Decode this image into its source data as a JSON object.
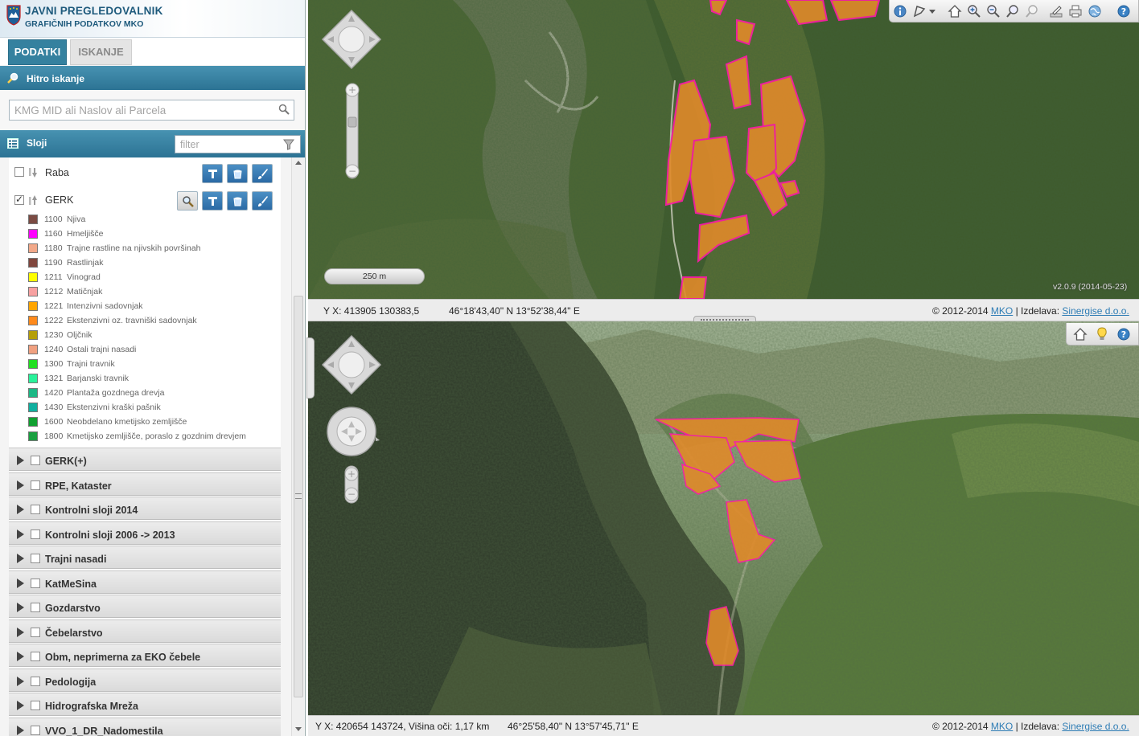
{
  "header": {
    "title_line1": "JAVNI PREGLEDOVALNIK",
    "title_line2": "GRAFIČNIH PODATKOV MKO"
  },
  "tabs": [
    {
      "label": "PODATKI"
    },
    {
      "label": "ISKANJE"
    }
  ],
  "quick_search": {
    "title": "Hitro iskanje",
    "placeholder": "KMG MID ali Naslov ali Parcela"
  },
  "layers_panel": {
    "title": "Sloji",
    "filter_placeholder": "filter"
  },
  "layers": [
    {
      "name": "Raba",
      "checked": false
    },
    {
      "name": "GERK",
      "checked": true
    }
  ],
  "legend": [
    {
      "code": "1100",
      "label": "Njiva",
      "color": "#7b4b43"
    },
    {
      "code": "1160",
      "label": "Hmeljišče",
      "color": "#ff00ff"
    },
    {
      "code": "1180",
      "label": "Trajne rastline na njivskih površinah",
      "color": "#f2a98a"
    },
    {
      "code": "1190",
      "label": "Rastlinjak",
      "color": "#80473e"
    },
    {
      "code": "1211",
      "label": "Vinograd",
      "color": "#ffff00"
    },
    {
      "code": "1212",
      "label": "Matičnjak",
      "color": "#f7a1a1"
    },
    {
      "code": "1221",
      "label": "Intenzivni sadovnjak",
      "color": "#ffa500"
    },
    {
      "code": "1222",
      "label": "Ekstenzivni oz. travniški sadovnjak",
      "color": "#ff8a1c"
    },
    {
      "code": "1230",
      "label": "Oljčnik",
      "color": "#b59f0a"
    },
    {
      "code": "1240",
      "label": "Ostali trajni nasadi",
      "color": "#f0a080"
    },
    {
      "code": "1300",
      "label": "Trajni travnik",
      "color": "#22e022"
    },
    {
      "code": "1321",
      "label": "Barjanski travnik",
      "color": "#29f29a"
    },
    {
      "code": "1420",
      "label": "Plantaža gozdnega drevja",
      "color": "#1cb885"
    },
    {
      "code": "1430",
      "label": "Ekstenzivni kraški pašnik",
      "color": "#10b0a0"
    },
    {
      "code": "1600",
      "label": "Neobdelano kmetijsko zemljišče",
      "color": "#10a030"
    },
    {
      "code": "1800",
      "label": "Kmetijsko zemljišče, poraslo z gozdnim drevjem",
      "color": "#1aa040"
    }
  ],
  "groups": [
    {
      "label": "GERK(+)"
    },
    {
      "label": "RPE, Kataster"
    },
    {
      "label": "Kontrolni sloji 2014"
    },
    {
      "label": "Kontrolni sloji 2006 -> 2013"
    },
    {
      "label": "Trajni nasadi"
    },
    {
      "label": "KatMeSina"
    },
    {
      "label": "Gozdarstvo"
    },
    {
      "label": "Čebelarstvo"
    },
    {
      "label": "Obm, neprimerna za EKO čebele"
    },
    {
      "label": "Pedologija"
    },
    {
      "label": "Hidrografska Mreža"
    },
    {
      "label": "VVO_1_DR_Nadomestila"
    }
  ],
  "map2d": {
    "scale_label": "250 m",
    "version": "v2.0.9 (2014-05-23)",
    "coords_yx": "Y X: 413905 130383,5",
    "coords_geo": "46°18'43,40\" N 13°52'38,44\" E"
  },
  "map3d": {
    "coords_yx": "Y X: 420654 143724, Višina oči: 1,17 km",
    "coords_geo": "46°25'58,40\" N 13°57'45,71\" E"
  },
  "footer": {
    "copyright": "© 2012-2014",
    "mko_link": "MKO",
    "separator": " | Izdelava: ",
    "maker_link": "Sinergise d.o.o."
  },
  "colors": {
    "accent": "#2c7394",
    "parcel_fill": "#e08a2a",
    "parcel_border": "#ff1aa8"
  }
}
